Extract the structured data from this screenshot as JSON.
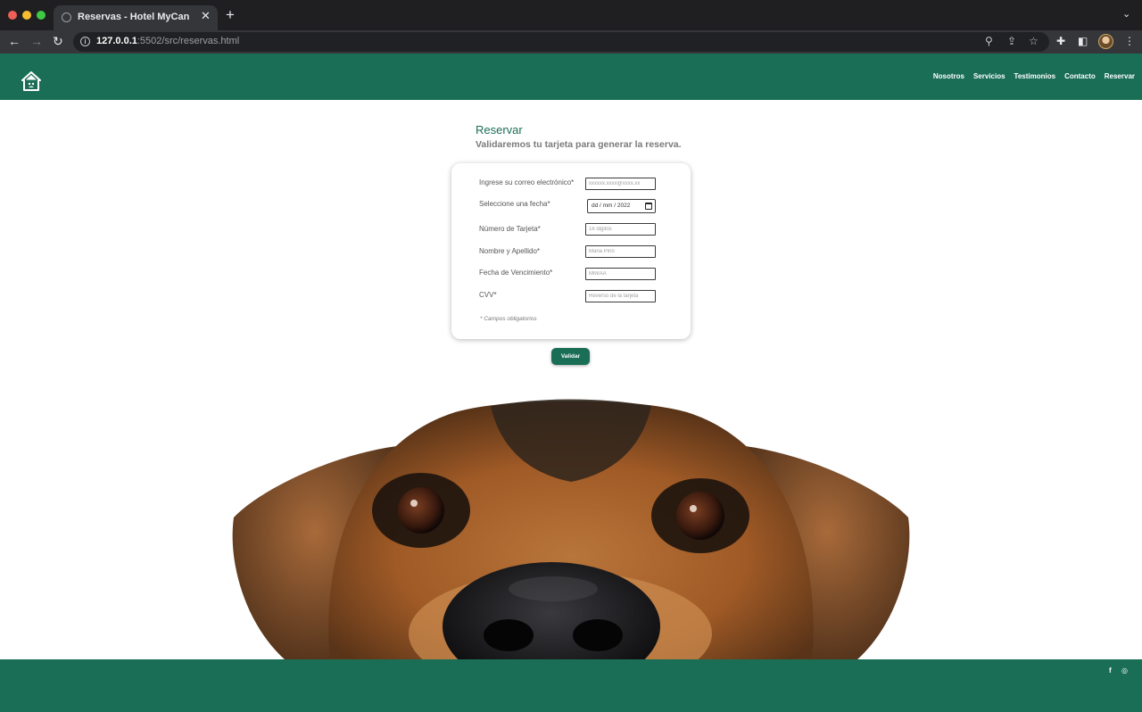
{
  "browser": {
    "tab_title": "Reservas - Hotel MyCan",
    "url_host": "127.0.0.1",
    "url_rest": ":5502/src/reservas.html"
  },
  "header": {
    "nav": [
      "Nosotros",
      "Servicios",
      "Testimonios",
      "Contacto",
      "Reservar"
    ],
    "brand_color": "#1a6e55"
  },
  "main": {
    "title": "Reservar",
    "subtitle": "Validaremos tu tarjeta para generar la reserva."
  },
  "form": {
    "email_label": "Ingrese su correo electrónico*",
    "email_placeholder": "xxxxxx.xxxx@xxxx.xx",
    "date_label": "Seleccione una fecha*",
    "date_value": "dd / mm / 2022",
    "card_label": "Número de Tarjeta*",
    "card_placeholder": "16 digitos",
    "name_label": "Nombre y Apellido*",
    "name_placeholder": "Maria Pino",
    "expiry_label": "Fecha de Vencimiento*",
    "expiry_placeholder": "MM/AA",
    "cvv_label": "CVV*",
    "cvv_placeholder": "Reverso de la tarjeta",
    "required_note": "* Campos obligatorios",
    "submit_label": "Validar"
  },
  "footer": {
    "social": [
      {
        "icon": "facebook-icon",
        "glyph": "f"
      },
      {
        "icon": "instagram-icon",
        "glyph": "◎"
      }
    ]
  }
}
